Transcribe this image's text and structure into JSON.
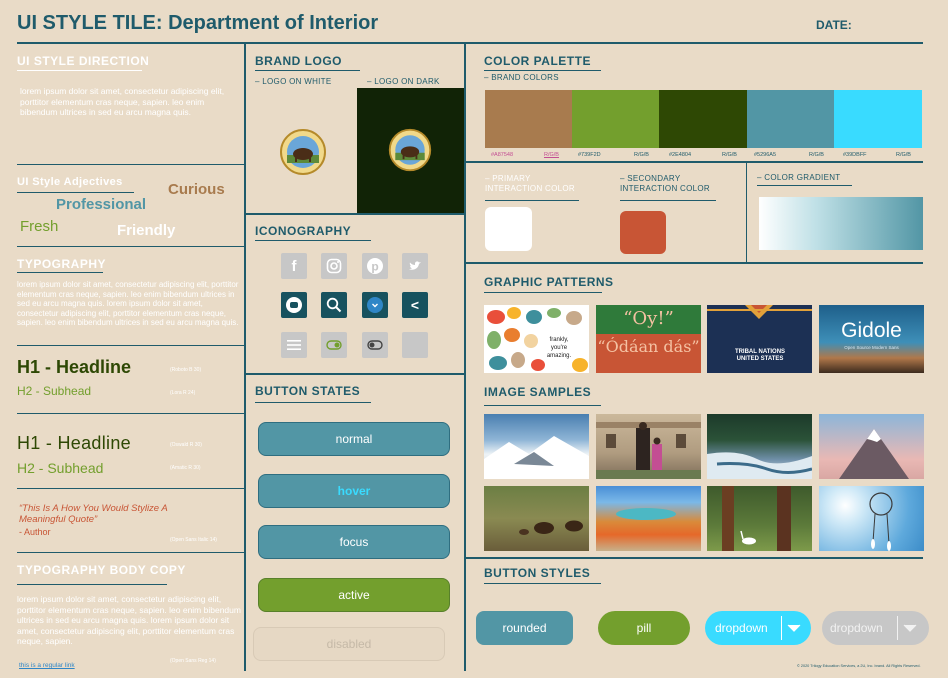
{
  "header": {
    "title": "UI STYLE TILE: Department of Interior",
    "date_label": "DATE:"
  },
  "style_direction": {
    "heading": "UI STYLE DIRECTION",
    "body": "lorem ipsum dolor sit amet, consectetur adipiscing elit, porttitor elementum cras neque, sapien. leo enim bibendum ultrices in sed eu arcu magna quis."
  },
  "adjectives": {
    "heading": "UI Style Adjectives",
    "items": [
      "Curious",
      "Professional",
      "Fresh",
      "Friendly"
    ]
  },
  "typography": {
    "heading": "TYPOGRAPHY",
    "body": "lorem ipsum dolor sit amet, consectetur adipiscing elit, porttitor elementum cras neque, sapien. leo enim bibendum ultrices in sed eu arcu magna quis. lorem ipsum dolor sit amet, consectetur adipiscing elit, porttitor elementum cras neque, sapien. leo enim bibendum ultrices in sed eu arcu magna quis.",
    "h1_a": "H1 - Headline",
    "h1_a_note": "(Roboto B 30)",
    "h2_a": "H2 - Subhead",
    "h2_a_note": "(Lora R 24)",
    "h1_b": "H1 - Headline",
    "h1_b_note": "(Oswald R 30)",
    "h2_b": "H2 - Subhead",
    "h2_b_note": "(Amatic R 30)",
    "quote": "“This Is A How You Would Stylize A Meaningful Quote”",
    "quote_author": " - Author",
    "quote_note": "(Open Sans Italic 14)"
  },
  "body_copy": {
    "heading": "TYPOGRAPHY BODY COPY",
    "body": "lorem ipsum dolor sit amet, consectetur adipiscing elit, porttitor elementum cras neque, sapien. leo enim bibendum ultrices in sed eu arcu magna quis. lorem ipsum dolor sit amet, consectetur adipiscing elit, porttitor elementum cras neque, sapien.",
    "link": "this is a regular link",
    "note": "(Open Sans Reg 14)"
  },
  "brand": {
    "heading": "BRAND LOGO",
    "on_white": "– LOGO ON WHITE",
    "on_dark": "– LOGO ON DARK"
  },
  "iconography": {
    "heading": "ICONOGRAPHY"
  },
  "button_states": {
    "heading": "BUTTON STATES",
    "normal": "normal",
    "hover": "hover",
    "focus": "focus",
    "active": "active",
    "disabled": "disabled"
  },
  "palette": {
    "heading": "COLOR PALETTE",
    "sub": "– BRAND COLORS",
    "swatches": [
      {
        "hex": "#A87B4E",
        "label": "#A87548",
        "rgb": "R/G/B"
      },
      {
        "hex": "#739F2D",
        "label": "#739F2D",
        "rgb": "R/G/B"
      },
      {
        "hex": "#2E4804",
        "label": "#2E4804",
        "rgb": "R/G/B"
      },
      {
        "hex": "#5296A5",
        "label": "#5296A5",
        "rgb": "R/G/B"
      },
      {
        "hex": "#39DBFF",
        "label": "#39DBFF",
        "rgb": "R/G/B"
      }
    ],
    "primary": "– PRIMARY INTERACTION COLOR",
    "secondary": "– SECONDARY INTERACTION COLOR",
    "gradient": "– COLOR GRADIENT"
  },
  "patterns": {
    "heading": "GRAPHIC PATTERNS",
    "t2_top": "“Oy!”",
    "t2_bottom": "“Ódáan dás”",
    "t3": "TRIBAL NATIONS UNITED STATES",
    "t4_title": "Gidole",
    "t4_sub": "Open Source Modern Sans"
  },
  "images": {
    "heading": "IMAGE SAMPLES"
  },
  "button_styles": {
    "heading": "BUTTON STYLES",
    "rounded": "rounded",
    "pill": "pill",
    "dropdown_active": "dropdown",
    "dropdown_disabled": "dropdown"
  },
  "footer": {
    "copyright": "© 2020 Trilogy Education Services, a 2U, Inc. brand. All Rights Reserved."
  },
  "colors": {
    "teal": "#5296A5",
    "dark_teal": "#1f5b6b",
    "green": "#739F2D",
    "orange": "#c85535",
    "cyan": "#39DBFF"
  }
}
